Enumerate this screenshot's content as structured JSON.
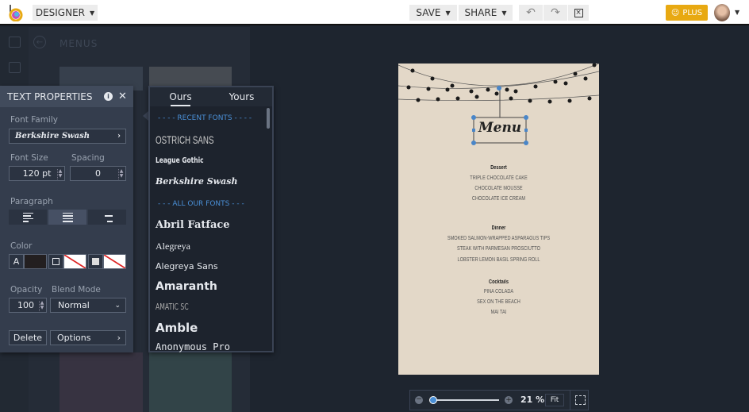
{
  "topbar": {
    "app_menu": "DESIGNER",
    "save": "SAVE",
    "share": "SHARE",
    "plus": "PLUS"
  },
  "sidebar": {
    "title": "MENUS"
  },
  "text_properties": {
    "title": "TEXT PROPERTIES",
    "font_family_label": "Font Family",
    "font_family": "Berkshire Swash",
    "font_size_label": "Font Size",
    "font_size": "120 pt",
    "spacing_label": "Spacing",
    "spacing": "0",
    "paragraph_label": "Paragraph",
    "paragraph_align": "center",
    "color_label": "Color",
    "color_letter": "A",
    "text_color": "#231f20",
    "opacity_label": "Opacity",
    "opacity": "100",
    "blend_label": "Blend Mode",
    "blend": "Normal",
    "delete": "Delete",
    "options": "Options"
  },
  "fonts": {
    "tabs": [
      "Ours",
      "Yours"
    ],
    "active_tab": "Ours",
    "recent_header": "- - - - RECENT FONTS - - - -",
    "recent": [
      "OSTRICH SANS",
      "League Gothic",
      "Berkshire Swash"
    ],
    "all_header": "- - - ALL OUR FONTS - - -",
    "all": [
      "Abril Fatface",
      "Alegreya",
      "Alegreya Sans",
      "Amaranth",
      "AMATIC SC",
      "Amble",
      "Anonymous Pro"
    ]
  },
  "canvas": {
    "title": "Menu",
    "sections": [
      {
        "heading": "Dessert",
        "items": [
          "TRIPLE CHOCOLATE CAKE",
          "CHOCOLATE MOUSSE",
          "CHOCOLATE ICE CREAM"
        ]
      },
      {
        "heading": "Dinner",
        "items": [
          "SMOKED SALMON-WRAPPED ASPARAGUS TIPS",
          "STEAK WITH PARMESAN PROSCIUTTO",
          "LOBSTER LEMON BASIL SPRING ROLL"
        ]
      },
      {
        "heading": "Cocktails",
        "items": [
          "PINA COLADA",
          "SEX ON THE BEACH",
          "MAI TAI"
        ]
      }
    ]
  },
  "zoom": {
    "value": "21 %",
    "fit": "Fit",
    "level_percent": 21
  },
  "colors": {
    "accent": "#4a8fd6",
    "plus": "#e8a912",
    "page": "#e3d8c8"
  }
}
